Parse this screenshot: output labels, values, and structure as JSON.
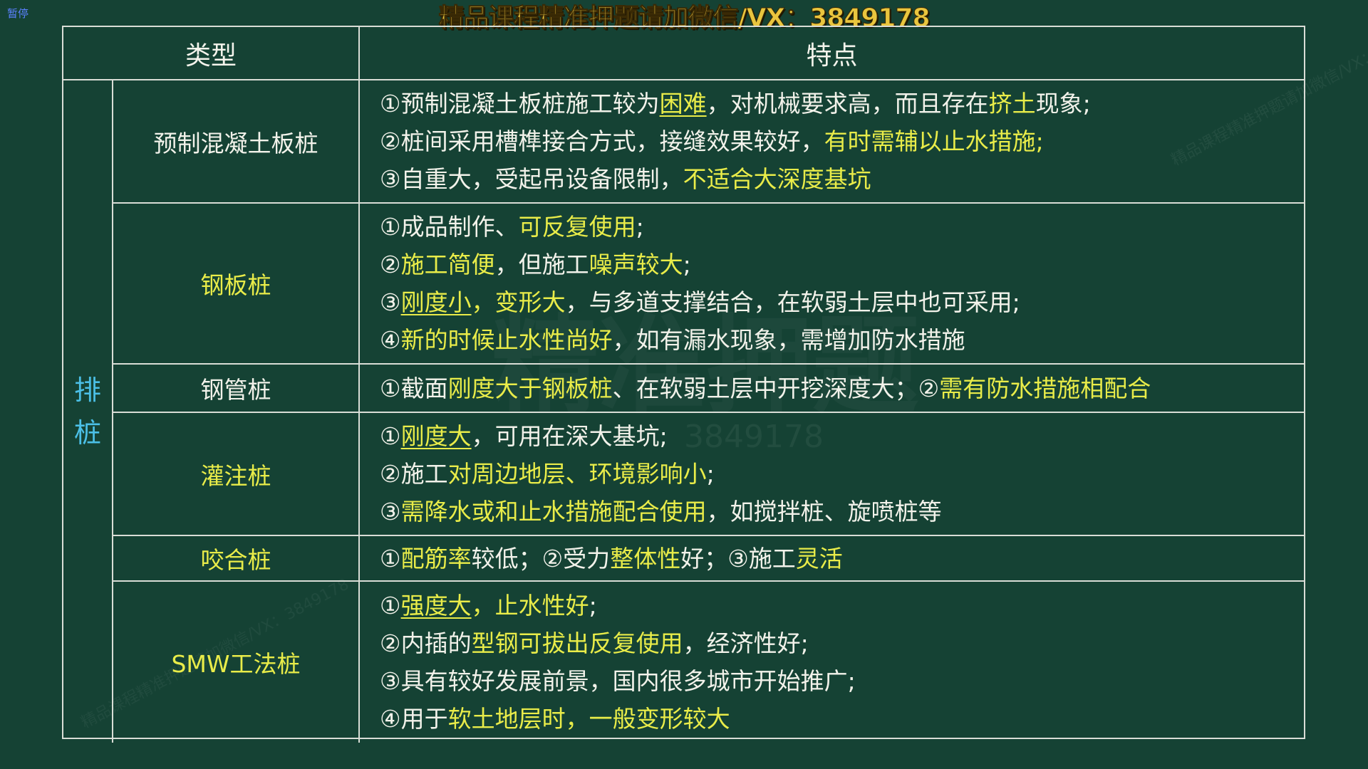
{
  "pause_label": "暂停",
  "header_banner": "精品课程精准押题请加微信/VX：3849178",
  "watermarks": {
    "faint": "精品课程精准押题请加微信/VX：3849178",
    "center": "精准押题",
    "number": "3849178"
  },
  "table": {
    "headers": [
      "类型",
      "特点"
    ],
    "category": [
      "排",
      "桩"
    ],
    "rows": [
      {
        "type": "预制混凝土板桩",
        "type_color": "#f2f2ea",
        "lines": [
          [
            {
              "t": "①预制混凝土板桩施工较为"
            },
            {
              "t": "困难",
              "h": 1,
              "u": 1
            },
            {
              "t": "，对机械要求高，而且存在"
            },
            {
              "t": "挤土",
              "h": 1
            },
            {
              "t": "现象;"
            }
          ],
          [
            {
              "t": "②桩间采用槽榫接合方式，接缝效果较好，"
            },
            {
              "t": "有时需辅以止水措施;",
              "h": 1
            }
          ],
          [
            {
              "t": "③自重大，受起吊设备限制，"
            },
            {
              "t": "不适合大深度基坑",
              "h": 1
            }
          ]
        ]
      },
      {
        "type": "钢板桩",
        "type_color": "#e9ec49",
        "lines": [
          [
            {
              "t": "①成品制作、"
            },
            {
              "t": "可反复使用",
              "h": 1
            },
            {
              "t": ";"
            }
          ],
          [
            {
              "t": "②"
            },
            {
              "t": "施工简便",
              "h": 1
            },
            {
              "t": "，但施工"
            },
            {
              "t": "噪声较大",
              "h": 1
            },
            {
              "t": ";"
            }
          ],
          [
            {
              "t": "③"
            },
            {
              "t": "刚度小",
              "h": 1,
              "u": 1
            },
            {
              "t": "，",
              "h": 1
            },
            {
              "t": "变形大",
              "h": 1
            },
            {
              "t": "，与多道支撑结合，在软弱土层中也可采用;"
            }
          ],
          [
            {
              "t": "④"
            },
            {
              "t": "新的时候止水性尚好",
              "h": 1
            },
            {
              "t": "，如有漏水现象，需增加防水措施"
            }
          ]
        ]
      },
      {
        "type": "钢管桩",
        "type_color": "#f2f2ea",
        "lines": [
          [
            {
              "t": "①截面"
            },
            {
              "t": "刚度大于钢板桩",
              "h": 1
            },
            {
              "t": "、在软弱土层中开挖深度大；②"
            },
            {
              "t": "需有防水措施相配合",
              "h": 1
            }
          ]
        ]
      },
      {
        "type": "灌注桩",
        "type_color": "#e9ec49",
        "lines": [
          [
            {
              "t": "①"
            },
            {
              "t": "刚度大",
              "h": 1,
              "u": 1
            },
            {
              "t": "，可用在深大基坑;"
            }
          ],
          [
            {
              "t": "②施工"
            },
            {
              "t": "对周边地层、环境影响小",
              "h": 1
            },
            {
              "t": ";"
            }
          ],
          [
            {
              "t": "③"
            },
            {
              "t": "需降水或和止水措施配合使用",
              "h": 1
            },
            {
              "t": "，如搅拌桩、旋喷桩等"
            }
          ]
        ]
      },
      {
        "type": "咬合桩",
        "type_color": "#e9ec49",
        "lines": [
          [
            {
              "t": "①"
            },
            {
              "t": "配筋率",
              "h": 1
            },
            {
              "t": "较低；②受力"
            },
            {
              "t": "整体性",
              "h": 1
            },
            {
              "t": "好；③施工"
            },
            {
              "t": "灵活",
              "h": 1
            }
          ]
        ]
      },
      {
        "type": "SMW工法桩",
        "type_color": "#e9ec49",
        "lines": [
          [
            {
              "t": "①"
            },
            {
              "t": "强度大",
              "h": 1,
              "u": 1
            },
            {
              "t": "，",
              "h": 1
            },
            {
              "t": "止水性好",
              "h": 1
            },
            {
              "t": ";"
            }
          ],
          [
            {
              "t": "②内插的"
            },
            {
              "t": "型钢可拔出反复使用",
              "h": 1
            },
            {
              "t": "，经济性好;"
            }
          ],
          [
            {
              "t": "③具有较好发展前景，国内很多城市开始推广;"
            }
          ],
          [
            {
              "t": "④用于"
            },
            {
              "t": "软土地层时，一般变形较大",
              "h": 1
            }
          ]
        ]
      }
    ]
  }
}
